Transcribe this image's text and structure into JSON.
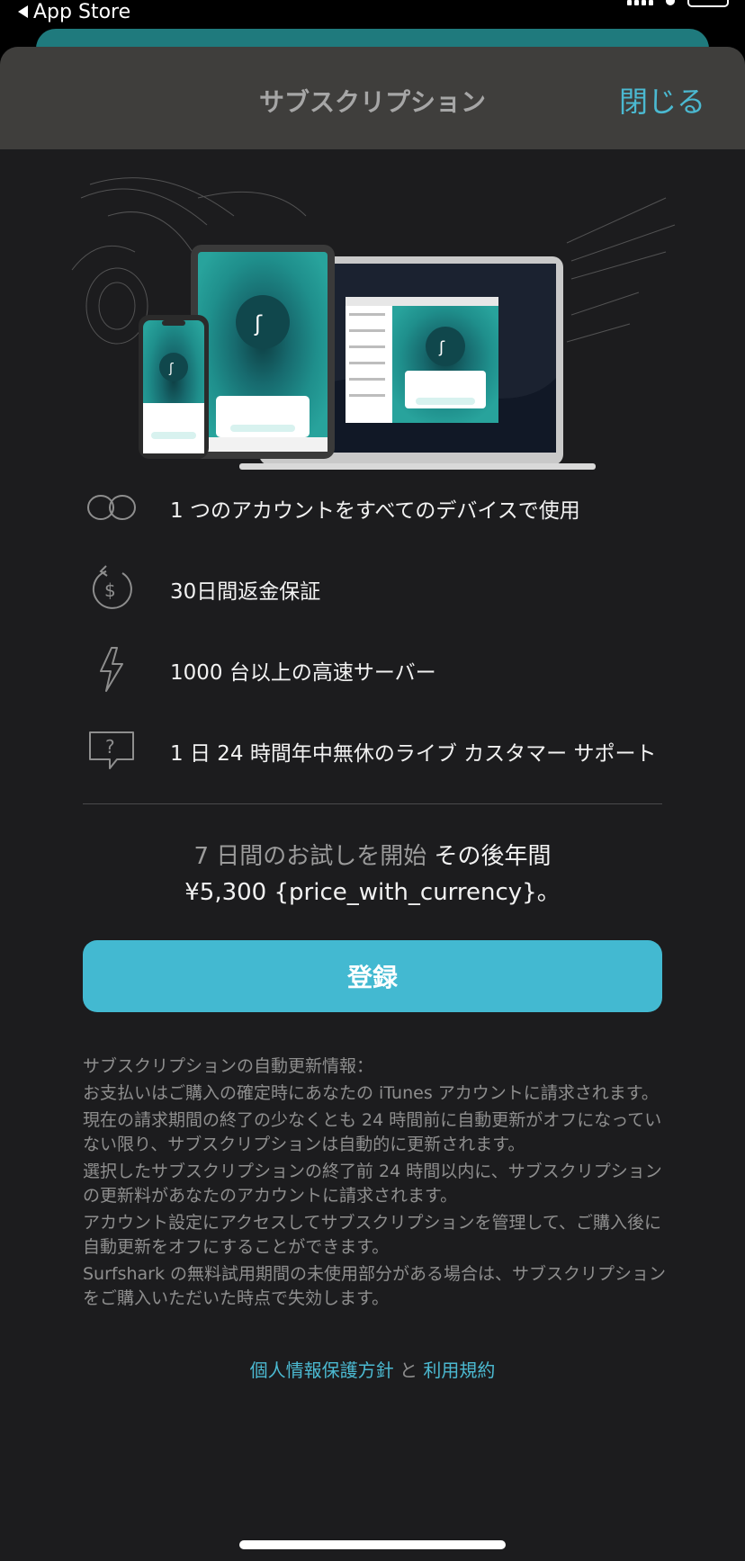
{
  "status_bar": {
    "back_label": "App Store"
  },
  "sheet": {
    "title": "サブスクリプション",
    "close_label": "閉じる"
  },
  "features": [
    {
      "icon": "infinity-icon",
      "label": "1 つのアカウントをすべてのデバイスで使用"
    },
    {
      "icon": "money-back-icon",
      "label": "30日間返金保証"
    },
    {
      "icon": "lightning-icon",
      "label": "1000 台以上の高速サーバー"
    },
    {
      "icon": "support-chat-icon",
      "label": "1 日 24 時間年中無休のライブ カスタマー サポート"
    }
  ],
  "pricing": {
    "trial_text": "7 日間のお試しを開始",
    "after_text": "その後年間",
    "price_line": "¥5,300 {price_with_currency}。"
  },
  "subscribe_button": "登録",
  "terms": [
    "サブスクリプションの自動更新情報：",
    "お支払いはご購入の確定時にあなたの iTunes アカウントに請求されます。",
    "現在の請求期間の終了の少なくとも 24 時間前に自動更新がオフになっていない限り、サブスクリプションは自動的に更新されます。",
    "選択したサブスクリプションの終了前 24 時間以内に、サブスクリプションの更新料があなたのアカウントに請求されます。",
    "アカウント設定にアクセスしてサブスクリプションを管理して、ご購入後に自動更新をオフにすることができます。",
    "Surfshark の無料試用期間の未使用部分がある場合は、サブスクリプションをご購入いただいた時点で失効します。"
  ],
  "links": {
    "privacy": "個人情報保護方針",
    "and": "と",
    "terms": "利用規約"
  },
  "colors": {
    "accent": "#43b9d1",
    "sheet_bg": "#1c1c1e",
    "header_bg": "#3f3e3c"
  }
}
